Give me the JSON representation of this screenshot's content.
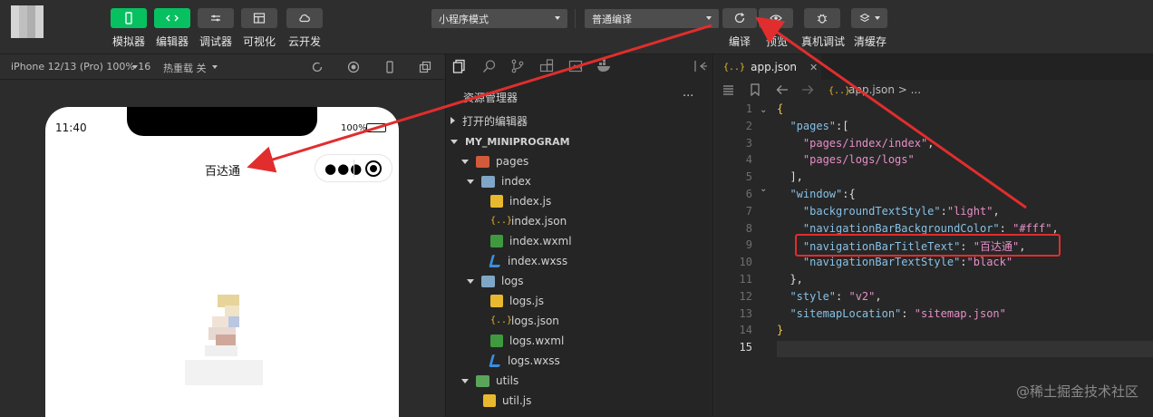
{
  "toolbar": {
    "buttons": [
      {
        "label": "模拟器"
      },
      {
        "label": "编辑器"
      },
      {
        "label": "调试器"
      },
      {
        "label": "可视化"
      },
      {
        "label": "云开发"
      }
    ],
    "mode_select": "小程序模式",
    "compile_select": "普通编译",
    "right_buttons": [
      {
        "label": "编译"
      },
      {
        "label": "预览"
      },
      {
        "label": "真机调试"
      },
      {
        "label": "清缓存"
      }
    ]
  },
  "simulator": {
    "device": "iPhone 12/13 (Pro) 100% 16",
    "hot_reload": "热重载 关",
    "time": "11:40",
    "battery": "100%",
    "nav_title": "百达通"
  },
  "explorer": {
    "title": "资源管理器",
    "more": "...",
    "open_editors": "打开的编辑器",
    "project": "MY_MINIPROGRAM",
    "tree": [
      {
        "label": "pages",
        "type": "folder-red",
        "depth": 1
      },
      {
        "label": "index",
        "type": "folder",
        "depth": 2
      },
      {
        "label": "index.js",
        "type": "js",
        "depth": 3
      },
      {
        "label": "index.json",
        "type": "json",
        "depth": 3
      },
      {
        "label": "index.wxml",
        "type": "wxml",
        "depth": 3
      },
      {
        "label": "index.wxss",
        "type": "wxss",
        "depth": 3
      },
      {
        "label": "logs",
        "type": "folder",
        "depth": 2
      },
      {
        "label": "logs.js",
        "type": "js",
        "depth": 3
      },
      {
        "label": "logs.json",
        "type": "json",
        "depth": 3
      },
      {
        "label": "logs.wxml",
        "type": "wxml",
        "depth": 3
      },
      {
        "label": "logs.wxss",
        "type": "wxss",
        "depth": 3
      },
      {
        "label": "utils",
        "type": "folder-green",
        "depth": 1
      },
      {
        "label": "util.js",
        "type": "js",
        "depth": 2
      }
    ]
  },
  "editor": {
    "tab": "app.json",
    "breadcrumb": "app.json > ...",
    "json_icon": "{..}",
    "line_numbers": [
      "1",
      "2",
      "3",
      "4",
      "5",
      "6",
      "7",
      "8",
      "9",
      "10",
      "11",
      "12",
      "13",
      "14",
      "15"
    ],
    "lines": [
      "{",
      "  \"pages\":[",
      "    \"pages/index/index\",",
      "    \"pages/logs/logs\"",
      "  ],",
      "  \"window\":{",
      "    \"backgroundTextStyle\":\"light\",",
      "    \"navigationBarBackgroundColor\": \"#fff\",",
      "    \"navigationBarTitleText\": \"百达通\",",
      "    \"navigationBarTextStyle\":\"black\"",
      "  },",
      "  \"style\": \"v2\",",
      "  \"sitemapLocation\": \"sitemap.json\"",
      "}",
      ""
    ]
  },
  "watermark": "@稀土掘金技术社区",
  "colors": {
    "accent_green": "#07c160",
    "annotation_red": "#e12d2d"
  }
}
